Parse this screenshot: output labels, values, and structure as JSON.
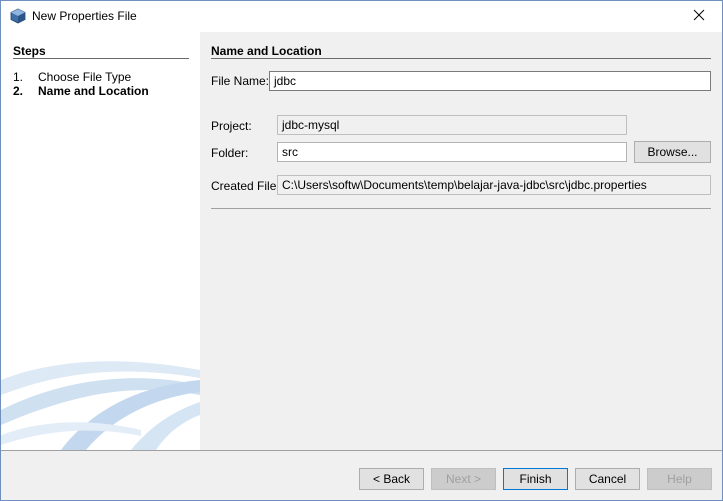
{
  "window": {
    "title": "New Properties File"
  },
  "steps": {
    "title": "Steps",
    "items": [
      {
        "num": "1.",
        "label": "Choose File Type"
      },
      {
        "num": "2.",
        "label": "Name and Location"
      }
    ]
  },
  "panel": {
    "title": "Name and Location",
    "file_name_label": "File Name:",
    "file_name_value": "jdbc",
    "project_label": "Project:",
    "project_value": "jdbc-mysql",
    "folder_label": "Folder:",
    "folder_value": "src",
    "browse_label": "Browse...",
    "created_file_label": "Created File:",
    "created_file_value": "C:\\Users\\softw\\Documents\\temp\\belajar-java-jdbc\\src\\jdbc.properties"
  },
  "buttons": {
    "back": "< Back",
    "next": "Next >",
    "finish": "Finish",
    "cancel": "Cancel",
    "help": "Help"
  },
  "icons": {
    "app": "netbeans-cube-icon",
    "close": "close-icon"
  },
  "colors": {
    "content_bg": "#f0f0f0",
    "default_button_border": "#0078d7",
    "swoosh": "#c9dcef"
  }
}
